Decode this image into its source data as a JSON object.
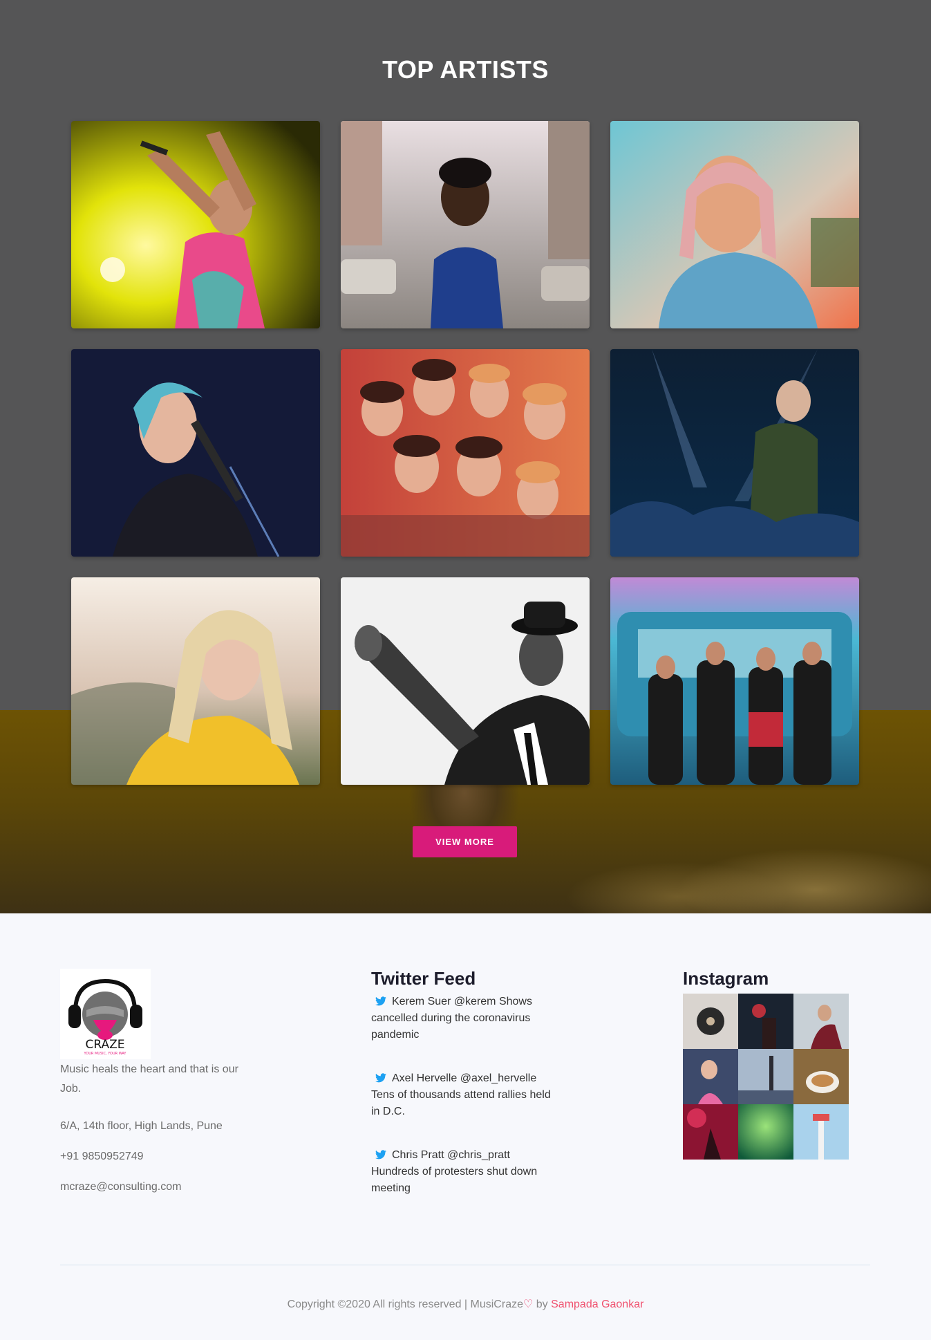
{
  "artists_section": {
    "title": "TOP ARTISTS",
    "view_more_label": "VIEW MORE",
    "photos": [
      {
        "name": "artist-photo-1"
      },
      {
        "name": "artist-photo-2"
      },
      {
        "name": "artist-photo-3"
      },
      {
        "name": "artist-photo-4"
      },
      {
        "name": "artist-photo-5"
      },
      {
        "name": "artist-photo-6"
      },
      {
        "name": "artist-photo-7"
      },
      {
        "name": "artist-photo-8"
      },
      {
        "name": "artist-photo-9"
      }
    ]
  },
  "footer": {
    "logo": {
      "brand": "CRAZE",
      "tagline": "YOUR MUSIC, YOUR WAY"
    },
    "about": "Music heals the heart and that is our Job.",
    "address": "6/A, 14th floor, High Lands, Pune",
    "phone": "+91 9850952749",
    "email": "mcraze@consulting.com",
    "twitter": {
      "title": "Twitter Feed",
      "tweets": [
        {
          "text": "Kerem Suer @kerem Shows cancelled during the coronavirus pandemic"
        },
        {
          "text": "Axel Hervelle @axel_hervelle Tens of thousands attend rallies held in D.C."
        },
        {
          "text": "Chris Pratt @chris_pratt Hundreds of protesters shut down meeting"
        }
      ]
    },
    "instagram": {
      "title": "Instagram"
    },
    "copyright": {
      "text": "Copyright ©2020 All rights reserved | MusiCraze",
      "by": " by ",
      "author": "Sampada Gaonkar"
    }
  },
  "colors": {
    "accent": "#d81b7a",
    "dark_section": "#555556",
    "footer_bg": "#f7f8fc",
    "twitter_blue": "#1da1f2",
    "author_link": "#f0506e"
  }
}
